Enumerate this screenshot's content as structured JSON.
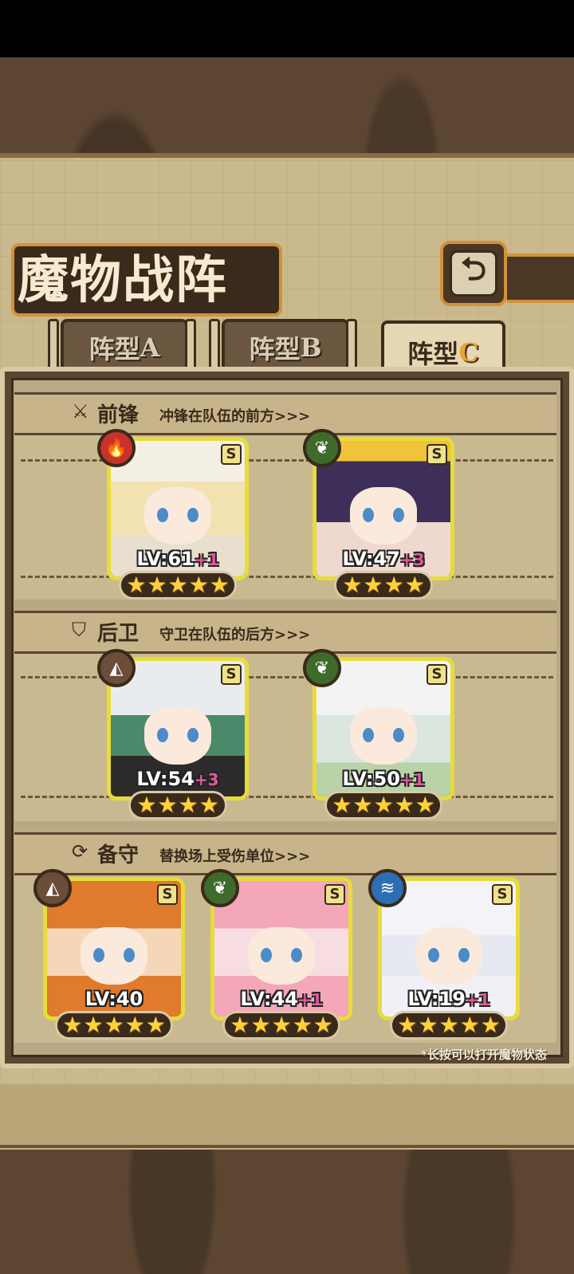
{
  "title": "魔物战阵",
  "back_icon": "return-arrow-icon",
  "tabs": [
    {
      "label": "阵型",
      "letter": "A",
      "active": false
    },
    {
      "label": "阵型",
      "letter": "B",
      "active": false
    },
    {
      "label": "阵型",
      "letter": "C",
      "active": true
    }
  ],
  "sections": {
    "front": {
      "title": "前锋",
      "desc": "冲锋在队伍的前方>>>",
      "icon": "sword-icon"
    },
    "rear": {
      "title": "后卫",
      "desc": "守卫在队伍的后方>>>",
      "icon": "shield-icon"
    },
    "reserve": {
      "title": "备守",
      "desc": "替换场上受伤单位>>>",
      "icon": "swap-icon"
    }
  },
  "units": [
    {
      "lv": "LV:61",
      "plus": "+1",
      "rank": "S",
      "stars": 5,
      "element": "fire",
      "elementColor": "#c8322b"
    },
    {
      "lv": "LV:47",
      "plus": "+3",
      "rank": "S",
      "stars": 4,
      "element": "nature",
      "elementColor": "#3f6b2a"
    },
    {
      "lv": "LV:54",
      "plus": "+3",
      "rank": "S",
      "stars": 4,
      "element": "earth",
      "elementColor": "#6b4d3a"
    },
    {
      "lv": "LV:50",
      "plus": "+1",
      "rank": "S",
      "stars": 5,
      "element": "nature",
      "elementColor": "#3f6b2a"
    },
    {
      "lv": "LV:40",
      "plus": "",
      "rank": "S",
      "stars": 5,
      "element": "earth",
      "elementColor": "#6b4d3a"
    },
    {
      "lv": "LV:44",
      "plus": "+1",
      "rank": "S",
      "stars": 5,
      "element": "nature",
      "elementColor": "#3f6b2a"
    },
    {
      "lv": "LV:19",
      "plus": "+1",
      "rank": "S",
      "stars": 5,
      "element": "water",
      "elementColor": "#2d6fb3"
    }
  ],
  "note": "*长按可以打开魔物状态"
}
